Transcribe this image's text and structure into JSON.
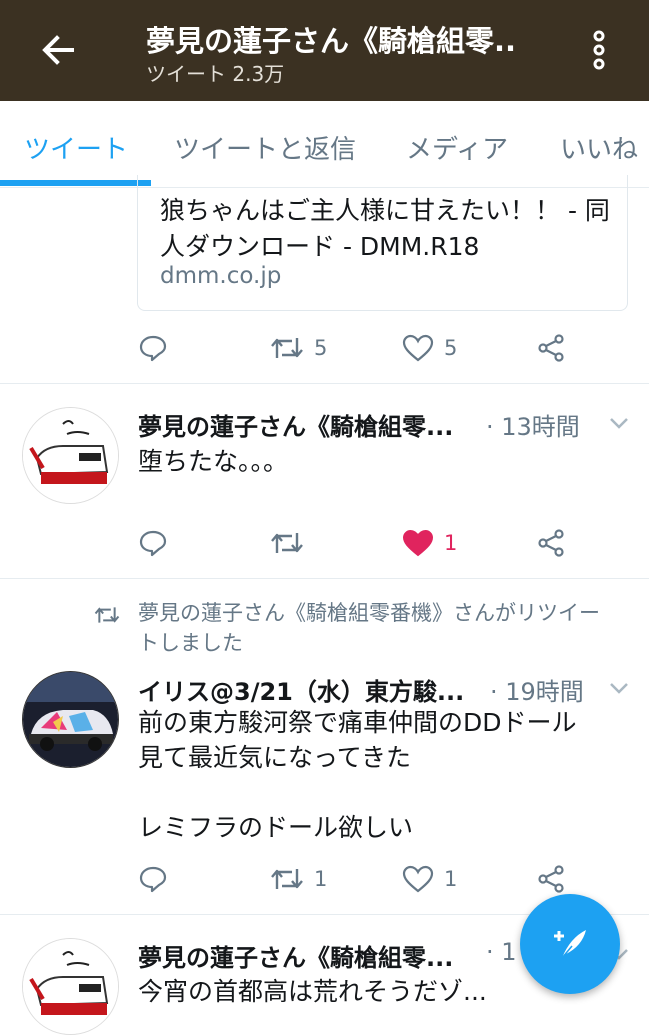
{
  "app_bar": {
    "title": "夢見の蓮子さん《騎槍組零..",
    "subtitle": "ツイート 2.3万",
    "back_icon": "arrow-left-icon",
    "menu_icon": "more-vertical-icon"
  },
  "tabs": [
    {
      "label": "ツイート",
      "active": true
    },
    {
      "label": "ツイートと返信",
      "active": false
    },
    {
      "label": "メディア",
      "active": false
    },
    {
      "label": "いいね",
      "active": false
    }
  ],
  "tweets": [
    {
      "link_card": {
        "title": "狼ちゃんはご主人様に甘えたい！！ - 同人ダウンロード - DMM.R18",
        "domain": "dmm.co.jp"
      },
      "retweets": "5",
      "likes": "5",
      "liked": false
    },
    {
      "name": "夢見の蓮子さん《騎槍組零...",
      "time": "· 13時間",
      "text": "堕ちたな。。。",
      "retweets": "",
      "likes": "1",
      "liked": true
    },
    {
      "retweeted_by": "夢見の蓮子さん《騎槍組零番機》さんがリツイートしました",
      "name": "イリス@3/21（水）東方駿...",
      "time": "· 19時間",
      "text": "前の東方駿河祭で痛車仲間のDDドール\n見て最近気になってきた\n\nレミフラのドール欲しい",
      "retweets": "1",
      "likes": "1",
      "liked": false
    },
    {
      "name": "夢見の蓮子さん《騎槍組零...",
      "time": "· 1",
      "text": "今宵の首都高は荒れそうだゾ..."
    }
  ],
  "fab": {
    "icon": "compose-tweet-icon"
  },
  "colors": {
    "app_bar": "#3b3122",
    "accent": "#1da1f2",
    "like": "#e0245e",
    "muted": "#657786"
  }
}
